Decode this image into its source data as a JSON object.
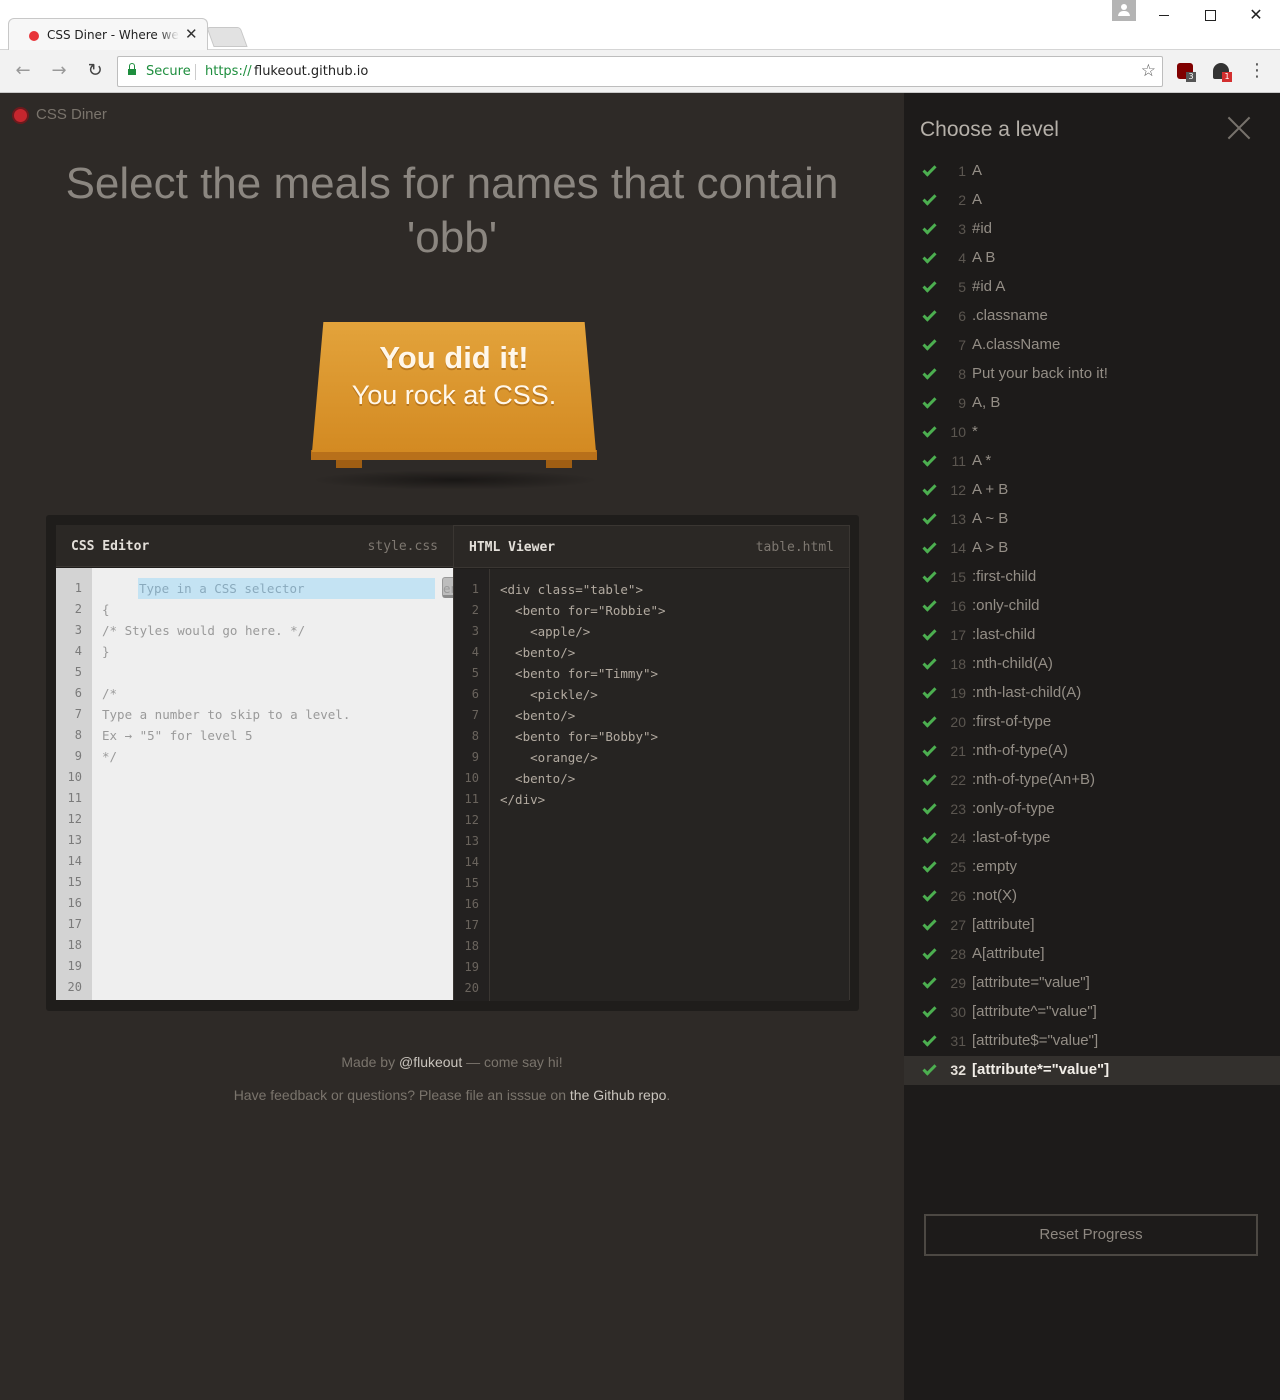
{
  "browser": {
    "tab_title": "CSS Diner - Where we feed you CSS",
    "tab_close_glyph": "✕",
    "secure_label": "Secure",
    "url_scheme": "https://",
    "url_host": "flukeout.github.io",
    "star_glyph": "☆",
    "back_glyph": "←",
    "forward_glyph": "→",
    "reload_glyph": "↻",
    "menu_glyph": "⋮",
    "close_glyph": "✕",
    "extensions": [
      {
        "name": "ublock-origin",
        "badge": "3"
      },
      {
        "name": "ghostery",
        "badge": "1"
      }
    ]
  },
  "app": {
    "brand": "CSS Diner",
    "order_instruction": "Select the meals for names that contain 'obb'",
    "win_title": "You did it!",
    "win_subtitle": "You rock at CSS."
  },
  "css_editor": {
    "title": "CSS Editor",
    "filename": "style.css",
    "input_placeholder": "Type in a CSS selector",
    "enter_label": "enter",
    "lines": [
      "",
      "{",
      "/* Styles would go here. */",
      "}",
      "",
      "/*",
      "Type a number to skip to a level.",
      "Ex → \"5\" for level 5",
      "*/",
      "",
      "",
      "",
      "",
      "",
      "",
      "",
      "",
      "",
      "",
      ""
    ],
    "line_numbers": [
      "1",
      "2",
      "3",
      "4",
      "5",
      "6",
      "7",
      "8",
      "9",
      "10",
      "11",
      "12",
      "13",
      "14",
      "15",
      "16",
      "17",
      "18",
      "19",
      "20"
    ]
  },
  "html_viewer": {
    "title": "HTML Viewer",
    "filename": "table.html",
    "lines": [
      "<div class=\"table\">",
      "  <bento for=\"Robbie\">",
      "    <apple/>",
      "  <bento/>",
      "  <bento for=\"Timmy\">",
      "    <pickle/>",
      "  <bento/>",
      "  <bento for=\"Bobby\">",
      "    <orange/>",
      "  <bento/>",
      "</div>",
      "",
      "",
      "",
      "",
      "",
      "",
      "",
      "",
      ""
    ],
    "line_numbers": [
      "1",
      "2",
      "3",
      "4",
      "5",
      "6",
      "7",
      "8",
      "9",
      "10",
      "11",
      "12",
      "13",
      "14",
      "15",
      "16",
      "17",
      "18",
      "19",
      "20"
    ]
  },
  "credits": {
    "made_by_prefix": "Made by ",
    "made_by_link": "@flukeout",
    "made_by_suffix": " — come say hi!",
    "feedback_prefix": "Have feedback or questions? Please file an isssue on ",
    "feedback_link": "the Github repo",
    "feedback_suffix": "."
  },
  "sidebar": {
    "title": "Choose a level",
    "reset_label": "Reset Progress",
    "current_level": 32,
    "levels": [
      {
        "num": "1",
        "name": "A"
      },
      {
        "num": "2",
        "name": "A"
      },
      {
        "num": "3",
        "name": "#id"
      },
      {
        "num": "4",
        "name": "A  B"
      },
      {
        "num": "5",
        "name": "#id  A"
      },
      {
        "num": "6",
        "name": ".classname"
      },
      {
        "num": "7",
        "name": "A.className"
      },
      {
        "num": "8",
        "name": "Put your back into it!"
      },
      {
        "num": "9",
        "name": "A, B"
      },
      {
        "num": "10",
        "name": "*"
      },
      {
        "num": "11",
        "name": "A  *"
      },
      {
        "num": "12",
        "name": "A + B"
      },
      {
        "num": "13",
        "name": "A ~ B"
      },
      {
        "num": "14",
        "name": "A > B"
      },
      {
        "num": "15",
        "name": ":first-child"
      },
      {
        "num": "16",
        "name": ":only-child"
      },
      {
        "num": "17",
        "name": ":last-child"
      },
      {
        "num": "18",
        "name": ":nth-child(A)"
      },
      {
        "num": "19",
        "name": ":nth-last-child(A)"
      },
      {
        "num": "20",
        "name": ":first-of-type"
      },
      {
        "num": "21",
        "name": ":nth-of-type(A)"
      },
      {
        "num": "22",
        "name": ":nth-of-type(An+B)"
      },
      {
        "num": "23",
        "name": ":only-of-type"
      },
      {
        "num": "24",
        "name": ":last-of-type"
      },
      {
        "num": "25",
        "name": ":empty"
      },
      {
        "num": "26",
        "name": ":not(X)"
      },
      {
        "num": "27",
        "name": "[attribute]"
      },
      {
        "num": "28",
        "name": "A[attribute]"
      },
      {
        "num": "29",
        "name": "[attribute=\"value\"]"
      },
      {
        "num": "30",
        "name": "[attribute^=\"value\"]"
      },
      {
        "num": "31",
        "name": "[attribute$=\"value\"]"
      },
      {
        "num": "32",
        "name": "[attribute*=\"value\"]"
      }
    ]
  },
  "colors": {
    "page_bg": "#2e2a27",
    "sidebar_bg": "#1d1b1a",
    "check_green": "#4caf50",
    "table_orange": "#d38a22",
    "input_highlight": "#c4e3f3"
  }
}
